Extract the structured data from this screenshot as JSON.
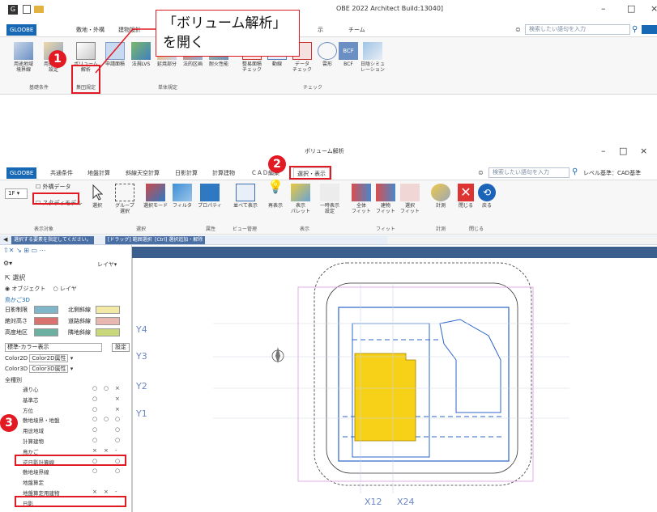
{
  "callout_text": "「ボリューム解析」を開く",
  "top_window": {
    "title": "OBE 2022 Architect Build:13040]",
    "menu": {
      "active_tab": "GLOOBE",
      "tabs": [
        "敷地・外構",
        "建物設計",
        "示",
        "チーム"
      ]
    },
    "search_placeholder": "検索したい語句を入力",
    "ribbon": [
      {
        "label": "用途地域\n境界線"
      },
      {
        "label": "用途区分\n設定"
      },
      {
        "label": "ボリューム\n解析"
      },
      {
        "label": "申請面積"
      },
      {
        "label": "法規LVS"
      },
      {
        "label": "延焼部分"
      },
      {
        "label": "法的区画"
      },
      {
        "label": "耐火性能"
      },
      {
        "label": "整易面積\nチェック"
      },
      {
        "label": "動線"
      },
      {
        "label": "データ\nチェック"
      },
      {
        "label": "雲形"
      },
      {
        "label": "BCF"
      },
      {
        "label": "日陰シミュ\nレーション"
      }
    ],
    "groups": [
      "基礎条件",
      "集団規定",
      "単体規定",
      "チェック"
    ]
  },
  "bottom_window": {
    "title": "ボリューム解析",
    "menu": {
      "active_tab": "GLOOBE",
      "tabs": [
        "共通条件",
        "地盤計算",
        "斜線天空計算",
        "日影計算",
        "計算建物",
        "ＣＡＤ編集",
        "選択・表示"
      ]
    },
    "search_placeholder": "検索したい語句を入力",
    "level_label": "レベル基準：CAD基準",
    "floor": "1F",
    "checkboxes": [
      {
        "label": "外構データ",
        "checked": false
      },
      {
        "label": "スタディモデル",
        "checked": false
      }
    ],
    "ribbon": [
      {
        "label": "選択"
      },
      {
        "label": "グループ\n選択"
      },
      {
        "label": "選択モード"
      },
      {
        "label": "フィルタ"
      },
      {
        "label": "プロパティ"
      },
      {
        "label": "並べて表示"
      },
      {
        "label": "再表示"
      },
      {
        "label": "表示\nパレット"
      },
      {
        "label": "一時表示\n設定"
      },
      {
        "label": "全体\nフィット"
      },
      {
        "label": "建物\nフィット"
      },
      {
        "label": "選択\nフィット"
      },
      {
        "label": "計測"
      },
      {
        "label": "閉じる"
      },
      {
        "label": "戻る"
      }
    ],
    "groups": [
      "表示対象",
      "選択",
      "属性",
      "ビュー管理",
      "表示",
      "フィット",
      "計測",
      "閉じる"
    ],
    "status": [
      "選択する要素を指定してください。",
      "[ドラッグ] 範囲選択",
      "[Ctrl] 選択追加・解除"
    ],
    "panel": {
      "layer_label": "レイヤ",
      "select_title": "選択",
      "radio_object": "オブジェクト",
      "radio_layer": "レイヤ",
      "torikago_title": "鳥かご3D",
      "legend": [
        {
          "label": "日影制限",
          "color": "#7fb7c9"
        },
        {
          "label": "北側斜線",
          "color": "#f3e9a6"
        },
        {
          "label": "絶対高さ",
          "color": "#d9716f"
        },
        {
          "label": "道路斜線",
          "color": "#e8b8b0"
        },
        {
          "label": "高度地区",
          "color": "#6bb0a0"
        },
        {
          "label": "隣地斜線",
          "color": "#c8d87a"
        }
      ],
      "display_mode": "標準-カラー表示",
      "settings": "設定",
      "color2d_label": "Color2D",
      "color2d_value": "Color2D属性",
      "color3d_label": "Color3D",
      "color3d_value": "Color3D属性",
      "all_types": "全種別",
      "rows": [
        {
          "label": "通り心",
          "v": [
            "○",
            "○",
            "×"
          ]
        },
        {
          "label": "基準芯",
          "v": [
            "○",
            "",
            "×"
          ]
        },
        {
          "label": "方位",
          "v": [
            "○",
            "",
            "×"
          ]
        },
        {
          "label": "敷地境界・地盤",
          "v": [
            "○",
            "○",
            "○"
          ]
        },
        {
          "label": "用途地域",
          "v": [
            "○",
            "",
            "○"
          ]
        },
        {
          "label": "計算建物",
          "v": [
            "○",
            "",
            "○"
          ]
        },
        {
          "label": "鳥かご",
          "v": [
            "×",
            "×",
            "-"
          ]
        },
        {
          "label": "逆日影計算線",
          "v": [
            "○",
            "",
            "○"
          ]
        },
        {
          "label": "敷地境界線",
          "v": [
            "○",
            "",
            "○"
          ]
        },
        {
          "label": "地盤算定",
          "v": [
            "",
            "",
            ""
          ]
        },
        {
          "label": "地盤算定用建物",
          "v": [
            "×",
            "×",
            "-"
          ]
        },
        {
          "label": "日影",
          "v": [
            "",
            "",
            ""
          ]
        }
      ]
    },
    "y_labels": [
      "Y4",
      "Y3",
      "Y2",
      "Y1"
    ],
    "x_labels": [
      "X12",
      "X24"
    ]
  },
  "badges": [
    "1",
    "2",
    "3"
  ],
  "colors": {
    "accent": "#e21a23",
    "brand": "#1769b5",
    "building": "#f7d117",
    "plan_line": "#2a64c8"
  }
}
